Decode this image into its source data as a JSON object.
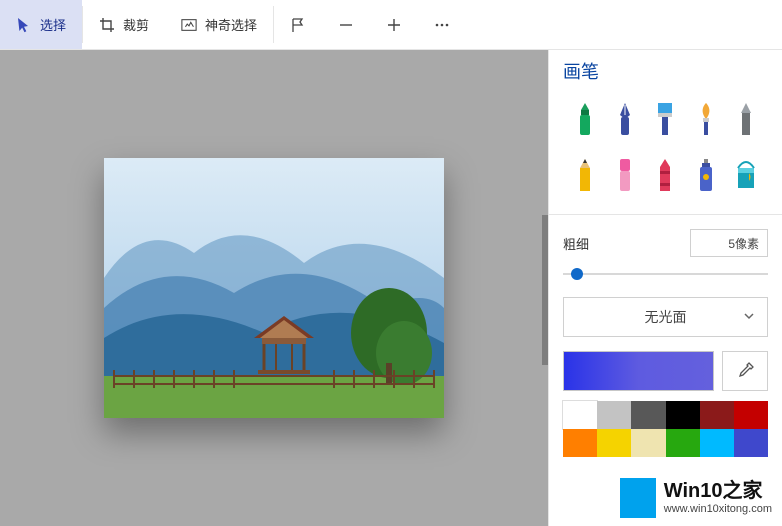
{
  "toolbar": {
    "select": {
      "label": "选择"
    },
    "crop": {
      "label": "裁剪"
    },
    "magic": {
      "label": "神奇选择"
    },
    "flag": {
      "label": ""
    },
    "minus": {
      "label": ""
    },
    "plus": {
      "label": ""
    },
    "more": {
      "label": ""
    }
  },
  "panel": {
    "title": "画笔",
    "brushes": [
      "marker",
      "calligraphy-pen",
      "brush-flat",
      "paint-brush",
      "pixel-pen",
      "pencil",
      "eraser",
      "crayon",
      "spray-can",
      "fill-bucket"
    ],
    "thickness_label": "粗细",
    "thickness_value": "5像素",
    "texture_label": "无光面",
    "current_color": "#3b3de0",
    "swatch_rows": [
      [
        "#ffffff",
        "#c3c3c3",
        "#585858",
        "#000000",
        "#8b1a1a",
        "#c40000"
      ],
      [
        "#ff7f00",
        "#f5d300",
        "#efe4b0",
        "#27a80f",
        "#00baff",
        "#3f48cc"
      ]
    ]
  },
  "watermark": {
    "title": "Win10之家",
    "url": "www.win10xitong.com"
  }
}
